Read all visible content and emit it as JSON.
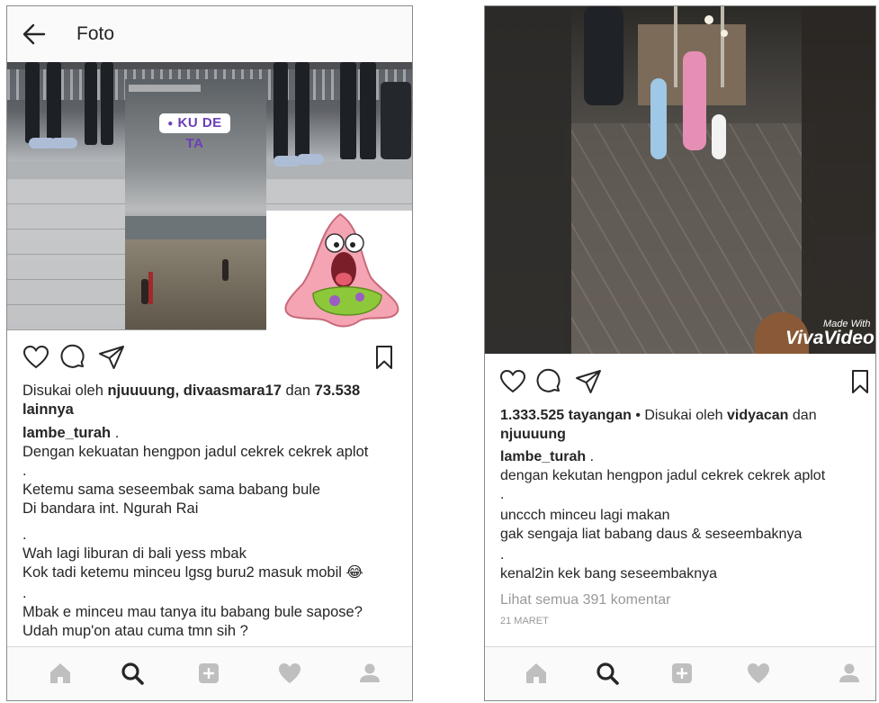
{
  "left_post": {
    "header": {
      "title": "Foto"
    },
    "story_overlay": {
      "tag_text": "KU DE TA"
    },
    "likes": {
      "prefix": "Disukai oleh ",
      "users": "njuuuung, divaasmara17",
      "middle": " dan ",
      "count": "73.538",
      "suffix": "lainnya"
    },
    "username": "lambe_turah",
    "username_suffix": " .",
    "caption_lines": [
      "Dengan kekuatan hengpon jadul cekrek cekrek aplot",
      ".",
      "Ketemu sama seseembak sama babang bule",
      "Di bandara int. Ngurah Rai",
      ".",
      "Wah lagi liburan di bali yess mbak",
      "Kok tadi ketemu minceu lgsg buru2 masuk mobil",
      ".",
      "Mbak e minceu mau tanya itu babang bule sapose?",
      "Udah mup'on atau cuma tmn sih ?"
    ],
    "emoji": "😂"
  },
  "right_post": {
    "video_watermark": {
      "line1": "Made With",
      "line2": "VivaVideo"
    },
    "views": {
      "count": "1.333.525 tayangan",
      "sep": " • Disukai oleh ",
      "user1": "vidyacan",
      "middle": " dan",
      "user2": "njuuuung"
    },
    "username": "lambe_turah",
    "username_suffix": " .",
    "caption_lines": [
      "dengan kekutan hengpon jadul cekrek cekrek aplot",
      ".",
      "unccch minceu lagi makan",
      "gak sengaja liat babang daus & seseembaknya",
      ".",
      "kenal2in kek bang seseembaknya"
    ],
    "comments_link": "Lihat semua 391 komentar",
    "date": "21 MARET"
  },
  "bottom_nav": {
    "items": [
      "home-icon",
      "search-icon",
      "add-icon",
      "heart-icon",
      "profile-icon"
    ],
    "active_color": "#262626",
    "inactive_color": "#bfbfbf"
  },
  "colors": {
    "story_tag": "#6b3fb8",
    "text": "#262626",
    "muted": "#999999"
  }
}
